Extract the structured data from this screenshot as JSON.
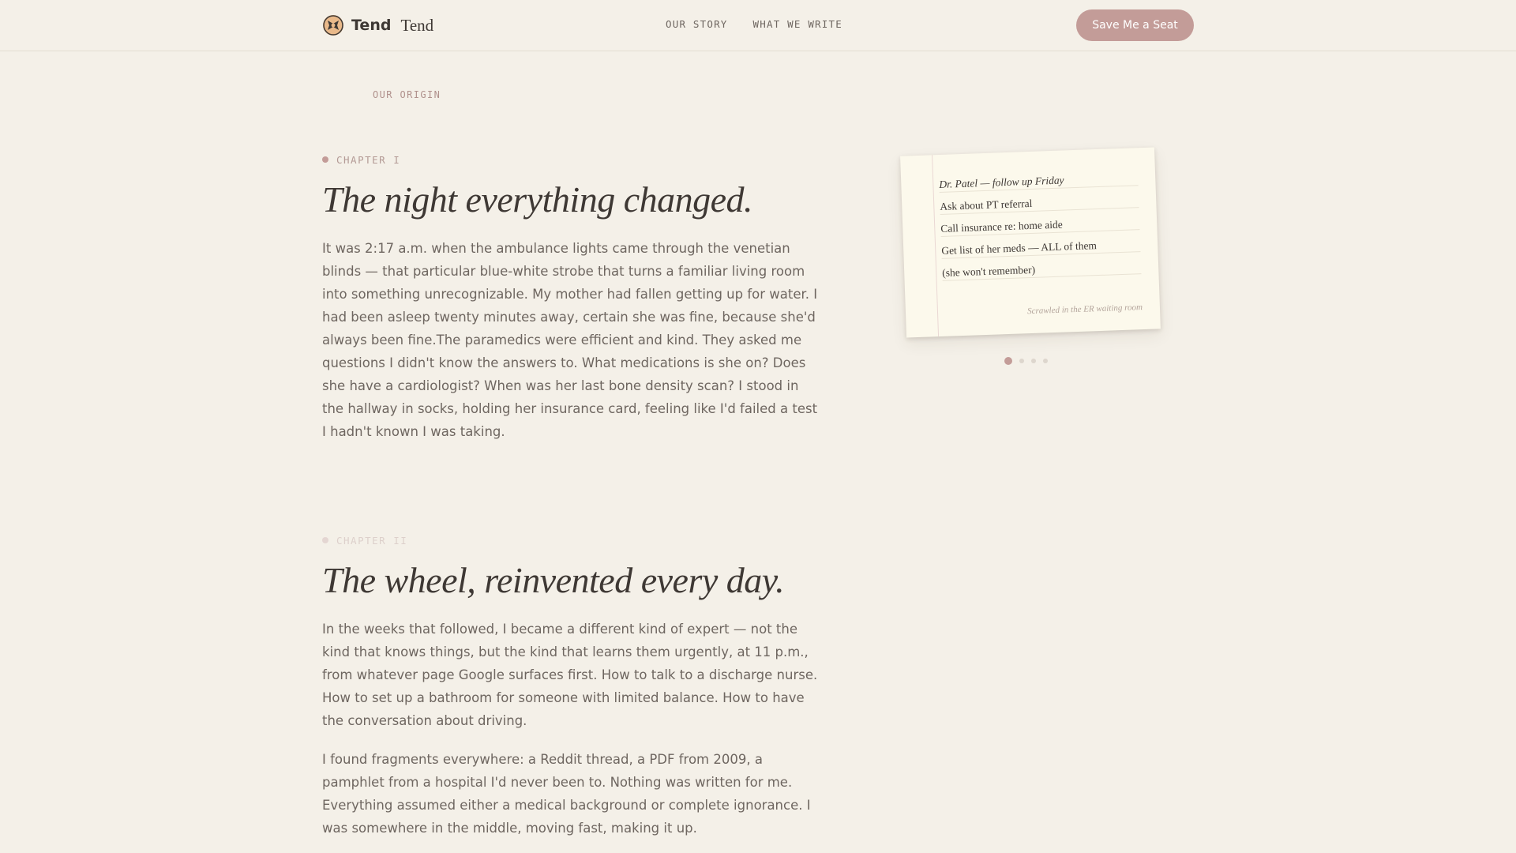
{
  "header": {
    "brand_name": "Tend",
    "brand_name_serif": "Tend",
    "nav": [
      "OUR STORY",
      "WHAT WE WRITE"
    ],
    "cta_label": "Save Me a Seat"
  },
  "origin": {
    "eyebrow": "OUR ORIGIN"
  },
  "chapters": [
    {
      "label": "CHAPTER I",
      "title": "The night everything changed.",
      "paragraphs": [
        "It was 2:17 a.m. when the ambulance lights came through the venetian blinds — that particular blue-white strobe that turns a familiar living room into something unrecognizable. My mother had fallen getting up for water. I had been asleep twenty minutes away, certain she was fine, because she'd always been fine.The paramedics were efficient and kind. They asked me questions I didn't know the answers to. What medications is she on? Does she have a cardiologist? When was her last bone density scan? I stood in the hallway in socks, holding her insurance card, feeling like I'd failed a test I hadn't known I was taking."
      ]
    },
    {
      "label": "CHAPTER II",
      "title": "The wheel, reinvented every day.",
      "paragraphs": [
        "In the weeks that followed, I became a different kind of expert — not the kind that knows things, but the kind that learns them urgently, at 11 p.m., from whatever page Google surfaces first. How to talk to a discharge nurse. How to set up a bathroom for someone with limited balance. How to have the conversation about driving.",
        "I found fragments everywhere: a Reddit thread, a PDF from 2009, a pamphlet from a hospital I'd never been to. Nothing was written for me. Everything assumed either a medical background or complete ignorance. I was somewhere in the middle, moving fast, making it up."
      ]
    }
  ],
  "note": {
    "lines": [
      "Dr. Patel — follow up Friday",
      "Ask about PT referral",
      "Call insurance re: home aide",
      "Get list of her meds — ALL of them",
      "(she won't remember)"
    ],
    "caption": "Scrawled in the ER waiting room"
  },
  "carousel": {
    "active_index": 0,
    "count": 4
  },
  "colors": {
    "background": "#f4f0e8",
    "accent": "#c39c98",
    "text": "#3e3834",
    "muted": "#6e6660"
  }
}
